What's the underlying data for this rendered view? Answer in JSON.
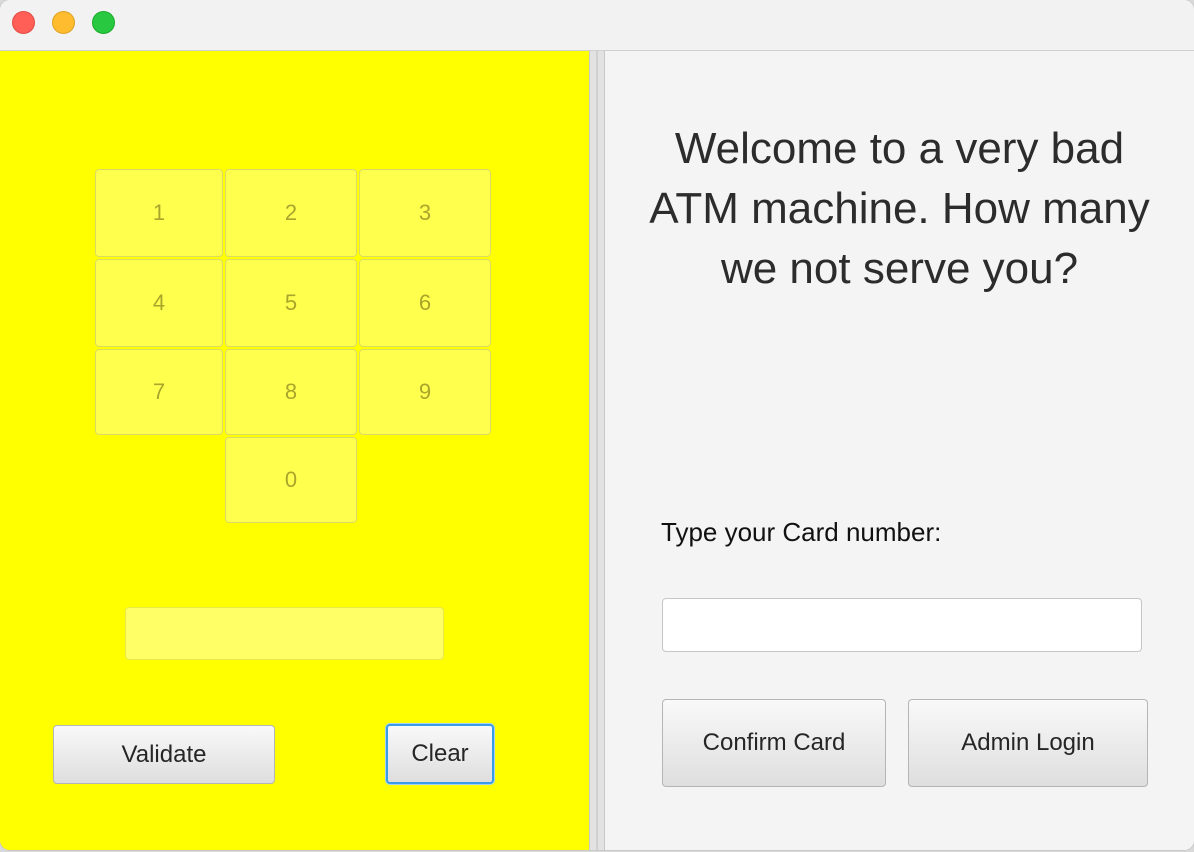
{
  "keypad": {
    "keys": [
      "1",
      "2",
      "3",
      "4",
      "5",
      "6",
      "7",
      "8",
      "9",
      "0"
    ]
  },
  "pin": {
    "value": ""
  },
  "left_buttons": {
    "validate_label": "Validate",
    "clear_label": "Clear"
  },
  "welcome": {
    "line1": "Welcome to a very bad",
    "line2": "ATM machine. How many",
    "line3": "we not serve you?"
  },
  "card": {
    "label": "Type your Card number:",
    "value": ""
  },
  "right_buttons": {
    "confirm_label": "Confirm Card",
    "admin_label": "Admin Login"
  },
  "colors": {
    "left_panel_bg": "#ffff00",
    "right_panel_bg": "#f4f4f4",
    "focus_ring": "#3a9be8"
  }
}
